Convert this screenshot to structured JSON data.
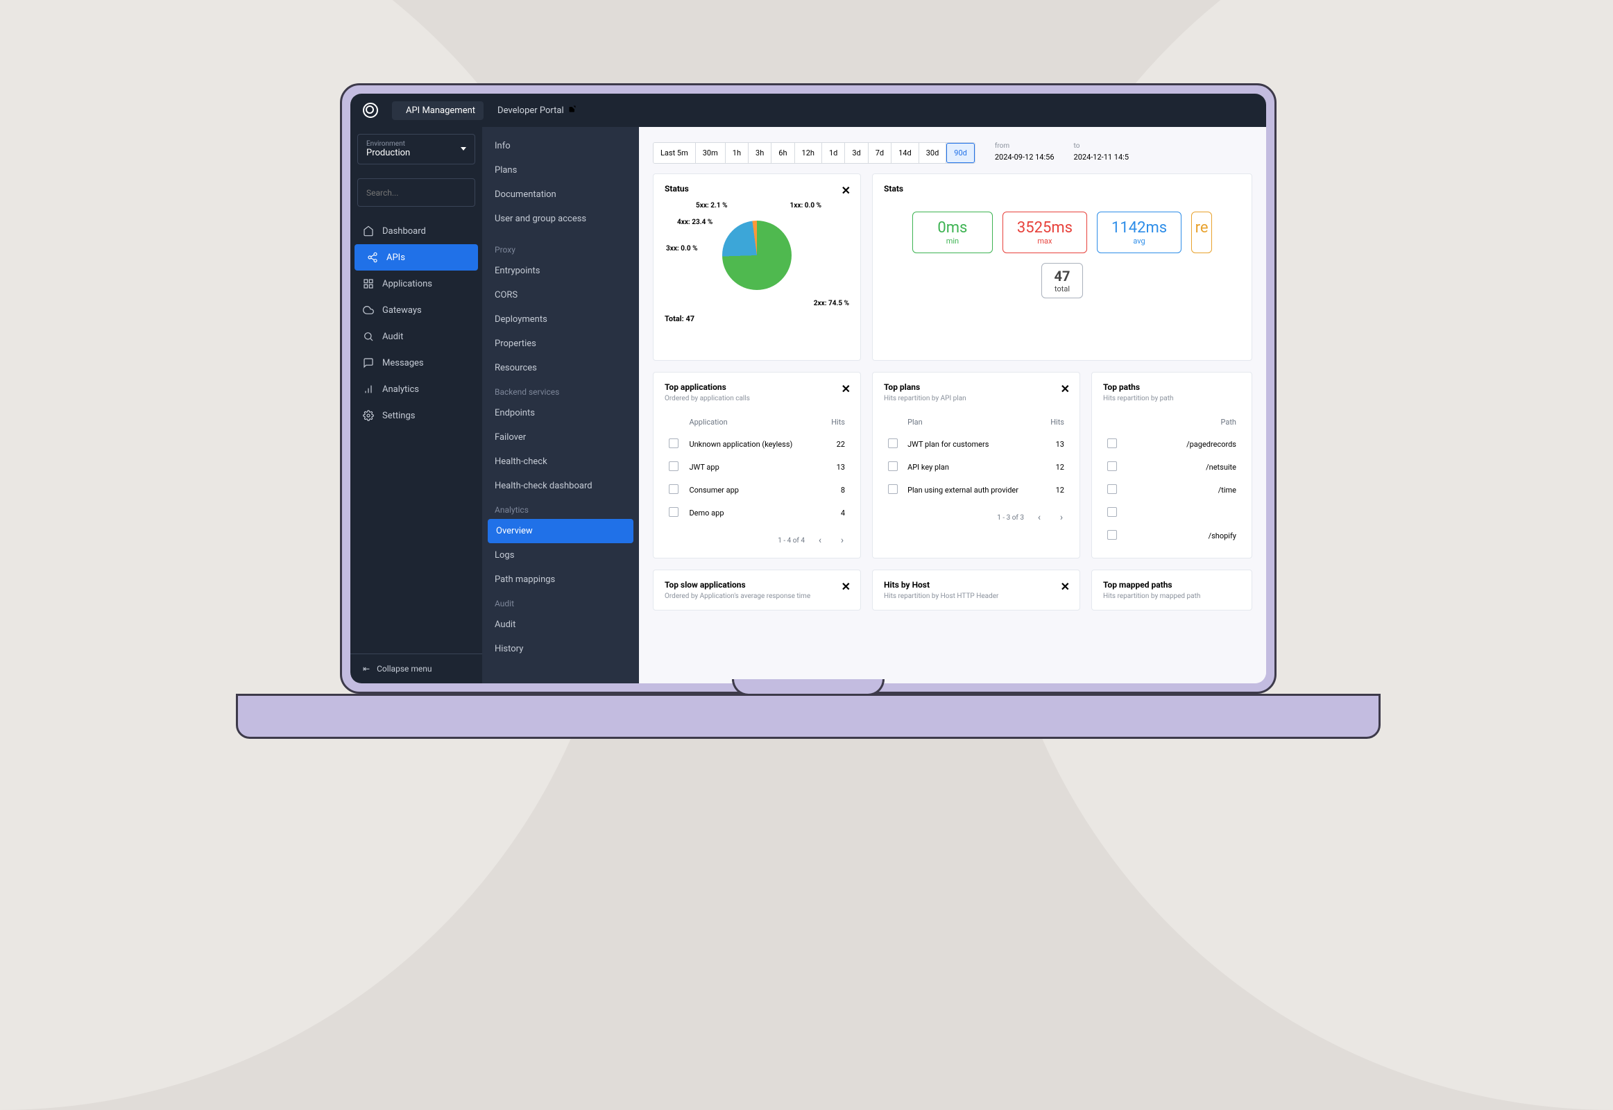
{
  "topbar": {
    "app_label": "API Management",
    "dev_portal": "Developer Portal"
  },
  "env": {
    "label": "Environment",
    "value": "Production"
  },
  "search": {
    "placeholder": "Search..."
  },
  "nav1": {
    "dashboard": "Dashboard",
    "apis": "APIs",
    "applications": "Applications",
    "gateways": "Gateways",
    "audit": "Audit",
    "messages": "Messages",
    "analytics": "Analytics",
    "settings": "Settings"
  },
  "collapse_menu": "Collapse menu",
  "nav2": {
    "info": "Info",
    "plans": "Plans",
    "documentation": "Documentation",
    "user_access": "User and group access",
    "proxy_header": "Proxy",
    "entrypoints": "Entrypoints",
    "cors": "CORS",
    "deployments": "Deployments",
    "properties": "Properties",
    "resources": "Resources",
    "backend_header": "Backend services",
    "endpoints": "Endpoints",
    "failover": "Failover",
    "health_check": "Health-check",
    "health_dash": "Health-check dashboard",
    "analytics_header": "Analytics",
    "overview": "Overview",
    "logs": "Logs",
    "path_mappings": "Path mappings",
    "audit_header": "Audit",
    "audit": "Audit",
    "history": "History"
  },
  "time_ranges": [
    "Last 5m",
    "30m",
    "1h",
    "3h",
    "6h",
    "12h",
    "1d",
    "3d",
    "7d",
    "14d",
    "30d",
    "90d"
  ],
  "time_active": "90d",
  "dates": {
    "from_label": "from",
    "from": "2024-09-12 14:56",
    "to_label": "to",
    "to": "2024-12-11 14:5"
  },
  "status": {
    "title": "Status",
    "total_label": "Total: 47",
    "labels": {
      "s1xx": "1xx: 0.0 %",
      "s2xx": "2xx: 74.5 %",
      "s3xx": "3xx: 0.0 %",
      "s4xx": "4xx: 23.4 %",
      "s5xx": "5xx: 2.1 %"
    }
  },
  "chart_data": {
    "type": "pie",
    "title": "Status",
    "total": 47,
    "series": [
      {
        "name": "1xx",
        "value": 0.0,
        "unit": "%"
      },
      {
        "name": "2xx",
        "value": 74.5,
        "unit": "%"
      },
      {
        "name": "3xx",
        "value": 0.0,
        "unit": "%"
      },
      {
        "name": "4xx",
        "value": 23.4,
        "unit": "%"
      },
      {
        "name": "5xx",
        "value": 2.1,
        "unit": "%"
      }
    ]
  },
  "stats": {
    "title": "Stats",
    "min": {
      "v": "0ms",
      "l": "min"
    },
    "max": {
      "v": "3525ms",
      "l": "max"
    },
    "avg": {
      "v": "1142ms",
      "l": "avg"
    },
    "req": {
      "v": "re",
      "l": ""
    },
    "total": {
      "v": "47",
      "l": "total"
    }
  },
  "top_apps": {
    "title": "Top applications",
    "sub": "Ordered by application calls",
    "cols": {
      "app": "Application",
      "hits": "Hits"
    },
    "rows": [
      {
        "app": "Unknown application (keyless)",
        "hits": "22"
      },
      {
        "app": "JWT app",
        "hits": "13"
      },
      {
        "app": "Consumer app",
        "hits": "8"
      },
      {
        "app": "Demo app",
        "hits": "4"
      }
    ],
    "pager": "1 - 4 of 4"
  },
  "top_plans": {
    "title": "Top plans",
    "sub": "Hits repartition by API plan",
    "cols": {
      "plan": "Plan",
      "hits": "Hits"
    },
    "rows": [
      {
        "plan": "JWT plan for customers",
        "hits": "13"
      },
      {
        "plan": "API key plan",
        "hits": "12"
      },
      {
        "plan": "Plan using external auth provider",
        "hits": "12"
      }
    ],
    "pager": "1 - 3 of 3"
  },
  "top_paths": {
    "title": "Top paths",
    "sub": "Hits repartition by path",
    "cols": {
      "path": "Path"
    },
    "rows": [
      {
        "path": "/pagedrecords"
      },
      {
        "path": "/netsuite"
      },
      {
        "path": "/time"
      },
      {
        "path": ""
      },
      {
        "path": "/shopify"
      }
    ]
  },
  "top_slow": {
    "title": "Top slow applications",
    "sub": "Ordered by Application's average response time"
  },
  "hits_host": {
    "title": "Hits by Host",
    "sub": "Hits repartition by Host HTTP Header"
  },
  "top_mapped": {
    "title": "Top mapped paths",
    "sub": "Hits repartition by mapped path"
  }
}
